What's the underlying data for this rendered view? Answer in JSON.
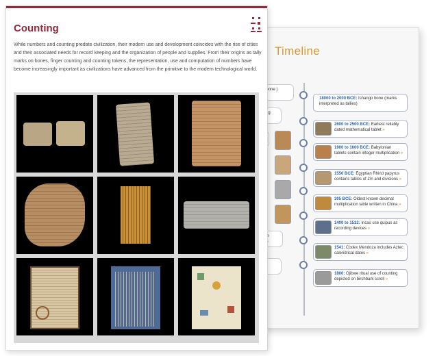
{
  "front": {
    "title": "Counting",
    "intro": "While numbers and counting predate civilization, their modern use and development coincides with the rise of cities and their associated needs for record keeping and the organization of people and supplies. From their origins as tally marks on bones, finger counting and counting tokens, the representation, use and computation of numbers have become increasingly important as civilizations have advanced from the primitive to the modern technological world.",
    "menu_icon": "grid-menu-icon",
    "accent_color": "#8e2b3d"
  },
  "gallery": {
    "items": [
      {
        "name": "ishango-bone-image"
      },
      {
        "name": "clay-tablet-image"
      },
      {
        "name": "babylonian-tablet-image"
      },
      {
        "name": "round-clay-tablet-image"
      },
      {
        "name": "tally-sticks-image"
      },
      {
        "name": "rhind-papyrus-image"
      },
      {
        "name": "manuscript-book-image"
      },
      {
        "name": "quipu-image"
      },
      {
        "name": "codex-mendoza-image"
      }
    ]
  },
  "back": {
    "title": "Timeline",
    "accent_color": "#d59a33",
    "partials": [
      {
        "text": "mbo bone\n)"
      },
      {
        "text": "ounting"
      },
      {
        "text": "s"
      },
      {
        "text": "ns use\nmbers"
      },
      {
        "text": "ary"
      }
    ],
    "items": [
      {
        "year": "18000 to 2000 BCE:",
        "text": "Ishango bone (marks interpreted as tallies)",
        "more": ""
      },
      {
        "year": "2600 to 2500 BCE:",
        "text": "Earliest reliably dated mathematical tablet",
        "more": "»"
      },
      {
        "year": "1900 to 1600 BCE:",
        "text": "Babylonian tablets contain integer multiplication",
        "more": "»"
      },
      {
        "year": "1550 BCE:",
        "text": "Egyptian Rhind papyrus contains tables of 2/n and divisions",
        "more": "»"
      },
      {
        "year": "305 BCE:",
        "text": "Oldest known decimal multiplication table written in China",
        "more": "»"
      },
      {
        "year": "1400 to 1532:",
        "text": "Incas use quipus as recording devices",
        "more": "»"
      },
      {
        "year": "1541:",
        "text": "Codex Mendoza includes Aztec calendrical dates",
        "more": "»"
      },
      {
        "year": "1800:",
        "text": "Ojibwe ritual use of counting depicted on birchbark scroll",
        "more": "»"
      }
    ]
  }
}
